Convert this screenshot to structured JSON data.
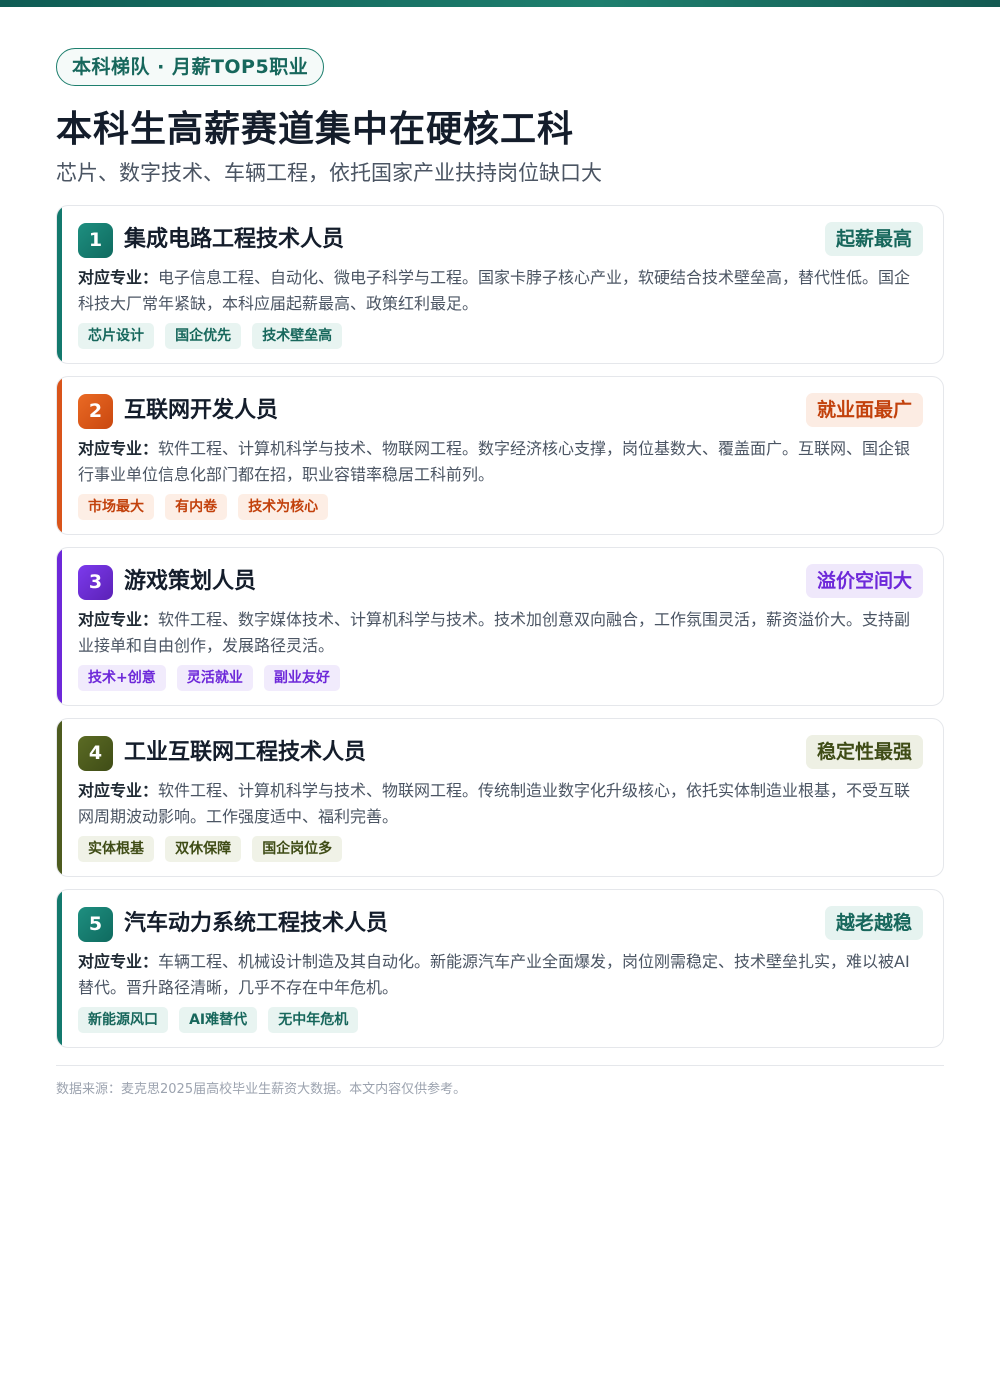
{
  "header": {
    "pill": "本科梯队 · 月薪TOP5职业",
    "title": "本科生高薪赛道集中在硬核工科",
    "subtitle": "芯片、数字技术、车辆工程，依托国家产业扶持岗位缺口大"
  },
  "desc_label": "对应专业：",
  "colors": {
    "teal": "#13796d",
    "orange": "#d9541a",
    "purple": "#6d28d9",
    "olive": "#4d5b1f"
  },
  "jobs": [
    {
      "num": "1",
      "name": "集成电路工程技术人员",
      "badge": "起薪最高",
      "desc": "电子信息工程、自动化、微电子科学与工程。国家卡脖子核心产业，软硬结合技术壁垒高，替代性低。国企科技大厂常年紧缺，本科应届起薪最高、政策红利最足。",
      "tags": [
        "芯片设计",
        "国企优先",
        "技术壁垒高"
      ]
    },
    {
      "num": "2",
      "name": "互联网开发人员",
      "badge": "就业面最广",
      "desc": "软件工程、计算机科学与技术、物联网工程。数字经济核心支撑，岗位基数大、覆盖面广。互联网、国企银行事业单位信息化部门都在招，职业容错率稳居工科前列。",
      "tags": [
        "市场最大",
        "有内卷",
        "技术为核心"
      ]
    },
    {
      "num": "3",
      "name": "游戏策划人员",
      "badge": "溢价空间大",
      "desc": "软件工程、数字媒体技术、计算机科学与技术。技术加创意双向融合，工作氛围灵活，薪资溢价大。支持副业接单和自由创作，发展路径灵活。",
      "tags": [
        "技术+创意",
        "灵活就业",
        "副业友好"
      ]
    },
    {
      "num": "4",
      "name": "工业互联网工程技术人员",
      "badge": "稳定性最强",
      "desc": "软件工程、计算机科学与技术、物联网工程。传统制造业数字化升级核心，依托实体制造业根基，不受互联网周期波动影响。工作强度适中、福利完善。",
      "tags": [
        "实体根基",
        "双休保障",
        "国企岗位多"
      ]
    },
    {
      "num": "5",
      "name": "汽车动力系统工程技术人员",
      "badge": "越老越稳",
      "desc": "车辆工程、机械设计制造及其自动化。新能源汽车产业全面爆发，岗位刚需稳定、技术壁垒扎实，难以被AI替代。晋升路径清晰，几乎不存在中年危机。",
      "tags": [
        "新能源风口",
        "AI难替代",
        "无中年危机"
      ]
    }
  ],
  "footer": "数据来源：麦克思2025届高校毕业生薪资大数据。本文内容仅供参考。"
}
